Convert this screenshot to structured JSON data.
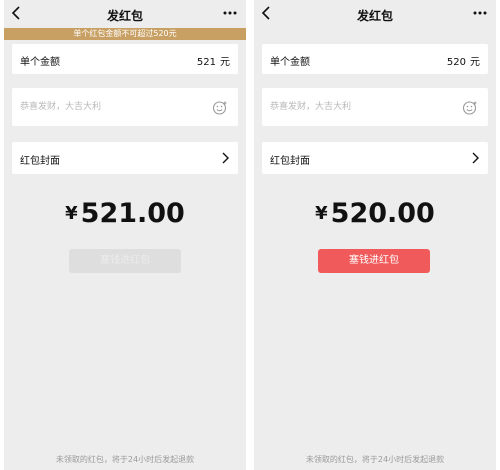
{
  "left_screen": {
    "header": {
      "title": "发红包"
    },
    "warning_banner": "单个红包金额不可超过520元",
    "amount_row": {
      "label": "单个金额",
      "value": "521",
      "unit": "元"
    },
    "message_row": {
      "placeholder": "恭喜发财，大吉大利"
    },
    "cover_row": {
      "label": "红包封面"
    },
    "total": {
      "currency": "¥",
      "amount": "521.00"
    },
    "submit_button": {
      "label": "塞钱进红包",
      "state": "disabled"
    },
    "footer_note": "未领取的红包，将于24小时后发起退款"
  },
  "right_screen": {
    "header": {
      "title": "发红包"
    },
    "amount_row": {
      "label": "单个金额",
      "value": "520",
      "unit": "元"
    },
    "message_row": {
      "placeholder": "恭喜发财，大吉大利"
    },
    "cover_row": {
      "label": "红包封面"
    },
    "total": {
      "currency": "¥",
      "amount": "520.00"
    },
    "submit_button": {
      "label": "塞钱进红包",
      "state": "active"
    },
    "footer_note": "未领取的红包，将于24小时后发起退款"
  },
  "icons": {
    "back": "back-icon",
    "more": "more-icon",
    "emoji": "emoji-icon",
    "chevron": "chevron-right-icon"
  },
  "colors": {
    "background": "#ededed",
    "banner": "#c8a064",
    "accent_red": "#f05a5a",
    "disabled_button": "#dedede"
  }
}
